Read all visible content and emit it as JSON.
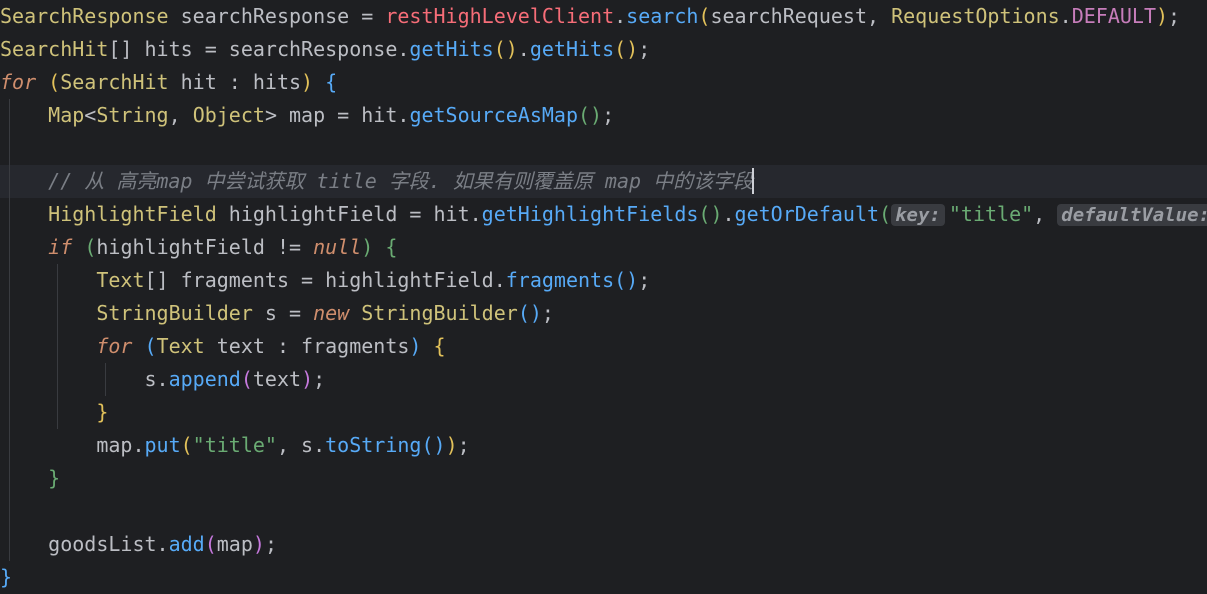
{
  "editor": {
    "lines": [
      [
        [
          "SearchResponse",
          "ty"
        ],
        [
          " searchResponse = ",
          ""
        ],
        [
          "restHighLevelClient",
          "fld"
        ],
        [
          ".",
          ""
        ],
        [
          "search",
          "mth"
        ],
        [
          "(",
          "p1"
        ],
        [
          "searchRequest, ",
          ""
        ],
        [
          "RequestOptions",
          "ty"
        ],
        [
          ".",
          ""
        ],
        [
          "DEFAULT",
          "cst"
        ],
        [
          ")",
          "p1"
        ],
        [
          ";",
          ""
        ]
      ],
      [
        [
          "SearchHit",
          "ty"
        ],
        [
          "[] hits = searchResponse.",
          ""
        ],
        [
          "getHits",
          "mth"
        ],
        [
          "()",
          "p1"
        ],
        [
          ".",
          ""
        ],
        [
          "getHits",
          "mth"
        ],
        [
          "()",
          "p1"
        ],
        [
          ";",
          ""
        ]
      ],
      [
        [
          "for",
          "kw"
        ],
        [
          " ",
          ""
        ],
        [
          "(",
          "p1"
        ],
        [
          "SearchHit",
          "ty"
        ],
        [
          " hit : hits",
          ""
        ],
        [
          ")",
          "p1"
        ],
        [
          " ",
          ""
        ],
        [
          "{",
          "p3"
        ]
      ],
      [
        [
          "    ",
          ""
        ],
        [
          "Map",
          "ty"
        ],
        [
          "<",
          ""
        ],
        [
          "String",
          "ty"
        ],
        [
          ", ",
          ""
        ],
        [
          "Object",
          "ty"
        ],
        [
          "> map = hit.",
          ""
        ],
        [
          "getSourceAsMap",
          "mth"
        ],
        [
          "()",
          "p4"
        ],
        [
          ";",
          ""
        ]
      ],
      [],
      [
        [
          "    ",
          ""
        ],
        [
          "// 从 高亮map 中尝试获取 title 字段. 如果有则覆盖原 map 中的该字段",
          "cmt"
        ]
      ],
      [
        [
          "    ",
          ""
        ],
        [
          "HighlightField",
          "ty"
        ],
        [
          " highlightField = hit.",
          ""
        ],
        [
          "getHighlightFields",
          "mth"
        ],
        [
          "()",
          "p4"
        ],
        [
          ".",
          ""
        ],
        [
          "getOrDefault",
          "mth"
        ],
        [
          "(",
          "p4"
        ],
        [
          "key:",
          "hint"
        ],
        [
          "\"title\"",
          "str"
        ],
        [
          ", ",
          ""
        ],
        [
          "defaultValue:",
          "hint"
        ]
      ],
      [
        [
          "    ",
          ""
        ],
        [
          "if",
          "kw"
        ],
        [
          " ",
          ""
        ],
        [
          "(",
          "p4"
        ],
        [
          "highlightField != ",
          ""
        ],
        [
          "null",
          "kw"
        ],
        [
          ")",
          "p4"
        ],
        [
          " ",
          ""
        ],
        [
          "{",
          "p4"
        ]
      ],
      [
        [
          "        ",
          ""
        ],
        [
          "Text",
          "ty"
        ],
        [
          "[] fragments = highlightField.",
          ""
        ],
        [
          "fragments",
          "mth"
        ],
        [
          "()",
          "p3"
        ],
        [
          ";",
          ""
        ]
      ],
      [
        [
          "        ",
          ""
        ],
        [
          "StringBuilder",
          "ty"
        ],
        [
          " s = ",
          ""
        ],
        [
          "new",
          "kw"
        ],
        [
          " ",
          ""
        ],
        [
          "StringBuilder",
          "ty"
        ],
        [
          "()",
          "p3"
        ],
        [
          ";",
          ""
        ]
      ],
      [
        [
          "        ",
          ""
        ],
        [
          "for",
          "kw"
        ],
        [
          " ",
          ""
        ],
        [
          "(",
          "p3"
        ],
        [
          "Text",
          "ty"
        ],
        [
          " text : fragments",
          ""
        ],
        [
          ")",
          "p3"
        ],
        [
          " ",
          ""
        ],
        [
          "{",
          "p1"
        ]
      ],
      [
        [
          "            ",
          ""
        ],
        [
          "s.",
          ""
        ],
        [
          "append",
          "mth"
        ],
        [
          "(",
          "p2"
        ],
        [
          "text",
          ""
        ],
        [
          ")",
          "p2"
        ],
        [
          ";",
          ""
        ]
      ],
      [
        [
          "        ",
          ""
        ],
        [
          "}",
          "p1"
        ]
      ],
      [
        [
          "        ",
          ""
        ],
        [
          "map.",
          ""
        ],
        [
          "put",
          "mth"
        ],
        [
          "(",
          "p1"
        ],
        [
          "\"title\"",
          "str"
        ],
        [
          ", s.",
          ""
        ],
        [
          "toString",
          "mth"
        ],
        [
          "()",
          "p3"
        ],
        [
          ")",
          "p1"
        ],
        [
          ";",
          ""
        ]
      ],
      [
        [
          "    ",
          ""
        ],
        [
          "}",
          "p4"
        ]
      ],
      [],
      [
        [
          "    ",
          ""
        ],
        [
          "goodsList.",
          ""
        ],
        [
          "add",
          "mth"
        ],
        [
          "(",
          "p2"
        ],
        [
          "map",
          ""
        ],
        [
          ")",
          "p2"
        ],
        [
          ";",
          ""
        ]
      ],
      [
        [
          "}",
          "p3"
        ]
      ]
    ]
  }
}
